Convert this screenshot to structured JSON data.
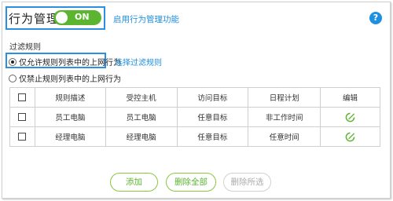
{
  "header": {
    "title": "行为管理",
    "toggle_label": "ON",
    "enable_link": "启用行为管理功能",
    "help_symbol": "?"
  },
  "filter": {
    "section_label": "过滤规则",
    "options": [
      {
        "label": "仅允许规则列表中的上网行为",
        "selected": true
      },
      {
        "label": "仅禁止规则列表中的上网行为",
        "selected": false
      }
    ],
    "select_link": "选择过滤规则"
  },
  "table": {
    "headers": [
      "规则描述",
      "受控主机",
      "访问目标",
      "日程计划",
      "编辑"
    ],
    "rows": [
      {
        "desc": "员工电脑",
        "host": "员工电脑",
        "target": "任意目标",
        "schedule": "非工作时间"
      },
      {
        "desc": "经理电脑",
        "host": "经理电脑",
        "target": "任意目标",
        "schedule": "任意时间"
      }
    ]
  },
  "buttons": {
    "add": "添加",
    "delete_all": "删除全部",
    "delete_selected": "删除所选"
  },
  "colors": {
    "accent_blue": "#1f8fe0",
    "toggle_green": "#5cb531",
    "button_border": "#8cc63f"
  }
}
